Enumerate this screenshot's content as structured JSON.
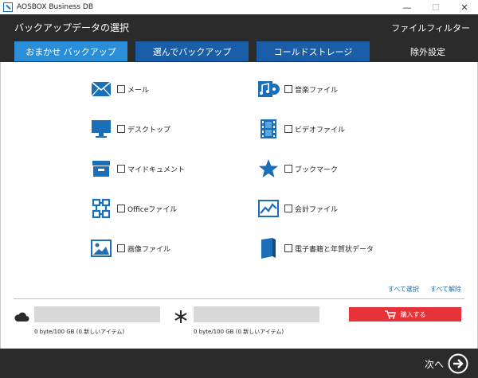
{
  "window": {
    "title": "AOSBOX Business DB",
    "controls": {
      "minimize": "—",
      "maximize": "☐",
      "close": "✕"
    }
  },
  "header": {
    "page_title": "バックアップデータの選択",
    "filter_link": "ファイルフィルター"
  },
  "tabs": [
    {
      "label": "おまかせ バックアップ",
      "active": true
    },
    {
      "label": "選んでバックアップ",
      "active": false
    },
    {
      "label": "コールドストレージ",
      "active": false
    },
    {
      "label": "除外設定",
      "active": false
    }
  ],
  "categories": {
    "left": [
      {
        "label": "メール",
        "icon": "envelope-icon",
        "checked": false
      },
      {
        "label": "デスクトップ",
        "icon": "monitor-icon",
        "checked": false
      },
      {
        "label": "マイドキュメント",
        "icon": "cabinet-icon",
        "checked": false
      },
      {
        "label": "Officeファイル",
        "icon": "office-icon",
        "checked": false
      },
      {
        "label": "画像ファイル",
        "icon": "image-icon",
        "checked": false
      }
    ],
    "right": [
      {
        "label": "音楽ファイル",
        "icon": "music-icon",
        "checked": false
      },
      {
        "label": "ビデオファイル",
        "icon": "film-icon",
        "checked": false
      },
      {
        "label": "ブックマーク",
        "icon": "star-icon",
        "checked": false
      },
      {
        "label": "会計ファイル",
        "icon": "chart-icon",
        "checked": false
      },
      {
        "label": "電子書籍と年賀状データ",
        "icon": "book-icon",
        "checked": false
      }
    ]
  },
  "selection_links": {
    "select_all": "すべて選択",
    "deselect_all": "すべて解除"
  },
  "storage": [
    {
      "icon": "cloud-icon",
      "usage_text": "0 byte/100 GB (0 新しいアイテム)",
      "used_fraction": 0
    },
    {
      "icon": "snowflake-icon",
      "usage_text": "0 byte/100 GB (0 新しいアイテム)",
      "used_fraction": 0
    }
  ],
  "buy_button": {
    "label": "購入する",
    "icon": "cart-icon"
  },
  "footer": {
    "next_label": "次へ",
    "next_icon": "arrow-right-circle-icon"
  },
  "colors": {
    "accent_blue": "#2a8fd8",
    "tab_blue": "#1a5ea8",
    "dark": "#2b2b2b",
    "buy_red": "#e8323a",
    "icon_blue": "#1a6fb8"
  }
}
